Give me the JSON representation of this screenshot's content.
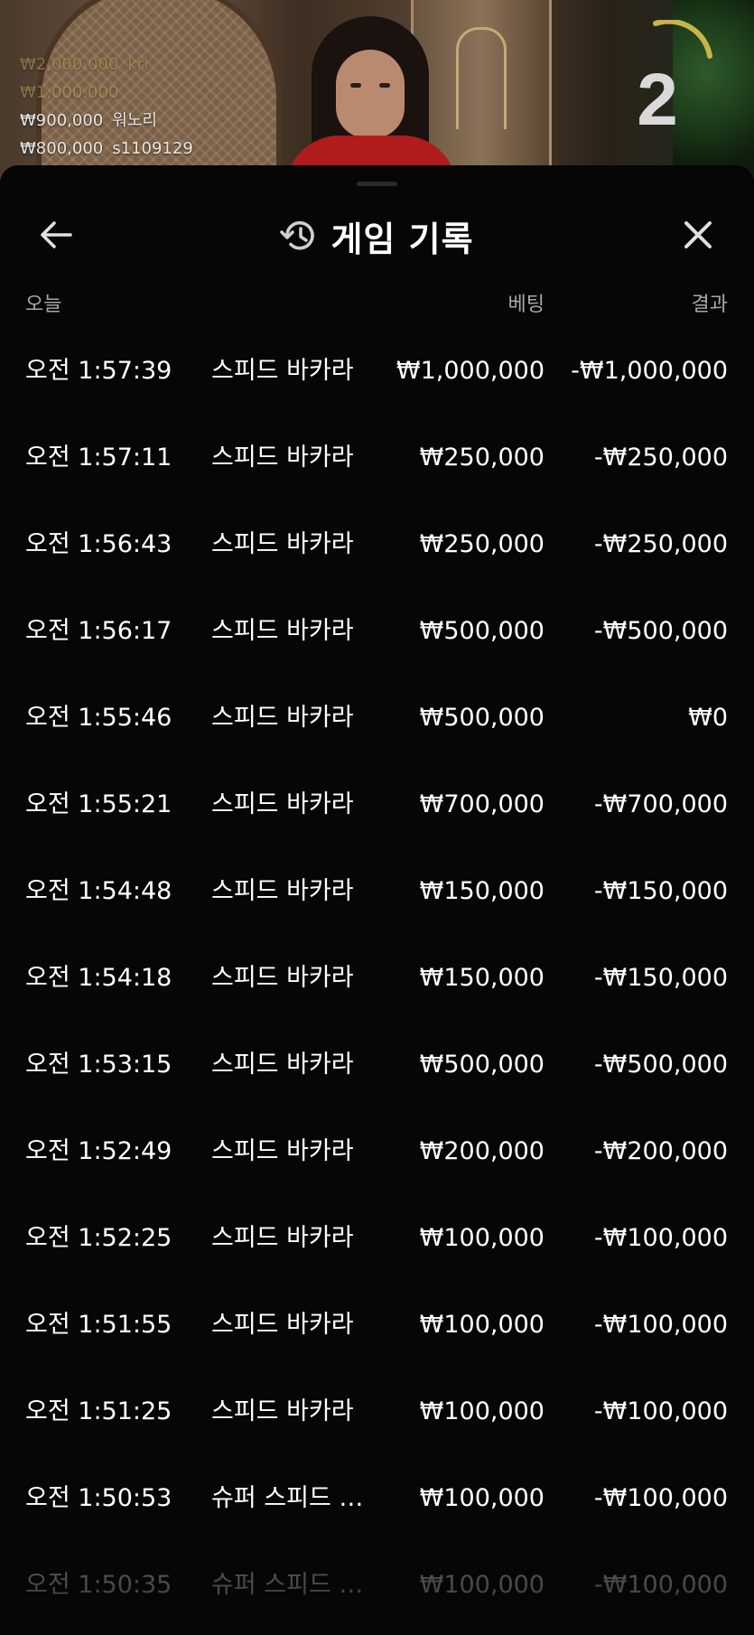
{
  "video": {
    "recent_bets": [
      {
        "amount": "₩2,000,000",
        "player": "kri",
        "style": "gold faded"
      },
      {
        "amount": "₩1,000,000",
        "player": "",
        "style": "gold faded"
      },
      {
        "amount": "₩900,000",
        "player": "워노리",
        "style": "white"
      },
      {
        "amount": "₩800,000",
        "player": "s1109129",
        "style": "white"
      }
    ],
    "countdown": "2",
    "colors": {
      "accent_gold": "#b89f57",
      "timer_arc": "#c9b44a"
    }
  },
  "header": {
    "title": "게임 기록",
    "back_icon": "arrow-left-icon",
    "history_icon": "history-clock-icon",
    "close_icon": "close-x-icon"
  },
  "columns": {
    "date": "오늘",
    "bet": "베팅",
    "result": "결과"
  },
  "rows": [
    {
      "time": "오전 1:57:39",
      "game": "스피드 바카라",
      "bet": "₩1,000,000",
      "result": "-₩1,000,000"
    },
    {
      "time": "오전 1:57:11",
      "game": "스피드 바카라",
      "bet": "₩250,000",
      "result": "-₩250,000"
    },
    {
      "time": "오전 1:56:43",
      "game": "스피드 바카라",
      "bet": "₩250,000",
      "result": "-₩250,000"
    },
    {
      "time": "오전 1:56:17",
      "game": "스피드 바카라",
      "bet": "₩500,000",
      "result": "-₩500,000"
    },
    {
      "time": "오전 1:55:46",
      "game": "스피드 바카라",
      "bet": "₩500,000",
      "result": "₩0"
    },
    {
      "time": "오전 1:55:21",
      "game": "스피드 바카라",
      "bet": "₩700,000",
      "result": "-₩700,000"
    },
    {
      "time": "오전 1:54:48",
      "game": "스피드 바카라",
      "bet": "₩150,000",
      "result": "-₩150,000"
    },
    {
      "time": "오전 1:54:18",
      "game": "스피드 바카라",
      "bet": "₩150,000",
      "result": "-₩150,000"
    },
    {
      "time": "오전 1:53:15",
      "game": "스피드 바카라",
      "bet": "₩500,000",
      "result": "-₩500,000"
    },
    {
      "time": "오전 1:52:49",
      "game": "스피드 바카라",
      "bet": "₩200,000",
      "result": "-₩200,000"
    },
    {
      "time": "오전 1:52:25",
      "game": "스피드 바카라",
      "bet": "₩100,000",
      "result": "-₩100,000"
    },
    {
      "time": "오전 1:51:55",
      "game": "스피드 바카라",
      "bet": "₩100,000",
      "result": "-₩100,000"
    },
    {
      "time": "오전 1:51:25",
      "game": "스피드 바카라",
      "bet": "₩100,000",
      "result": "-₩100,000"
    },
    {
      "time": "오전 1:50:53",
      "game": "슈퍼 스피드 바카라",
      "bet": "₩100,000",
      "result": "-₩100,000"
    },
    {
      "time": "오전 1:50:35",
      "game": "슈퍼 스피드 바카라",
      "bet": "₩100,000",
      "result": "-₩100,000"
    }
  ]
}
